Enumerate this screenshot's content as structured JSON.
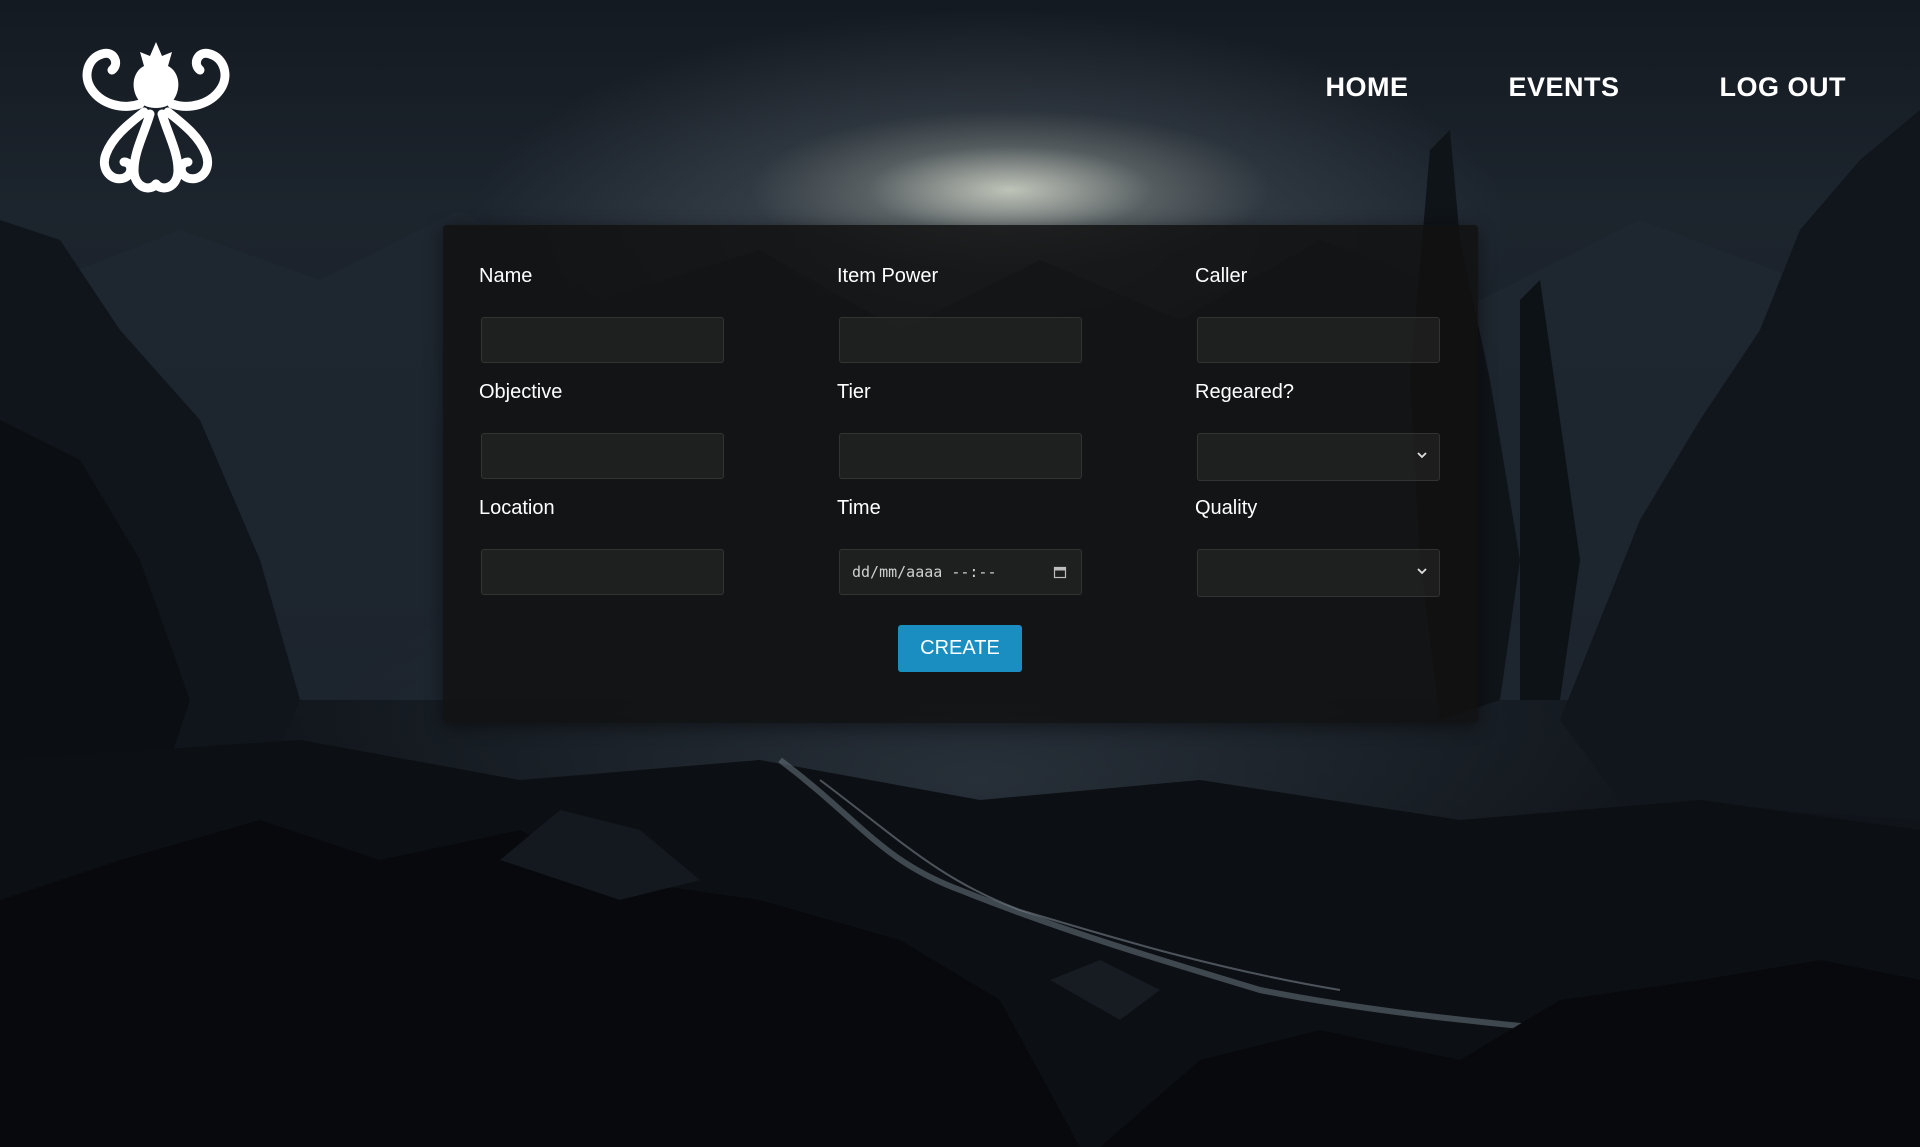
{
  "logo": {
    "icon": "kraken-icon"
  },
  "nav": {
    "items": [
      {
        "label": "HOME"
      },
      {
        "label": "EVENTS"
      },
      {
        "label": "LOG OUT"
      }
    ]
  },
  "form": {
    "fields": {
      "name": {
        "label": "Name",
        "value": ""
      },
      "item_power": {
        "label": "Item Power",
        "value": ""
      },
      "caller": {
        "label": "Caller",
        "value": ""
      },
      "objective": {
        "label": "Objective",
        "value": ""
      },
      "tier": {
        "label": "Tier",
        "value": ""
      },
      "regeared": {
        "label": "Regeared?",
        "value": ""
      },
      "location": {
        "label": "Location",
        "value": ""
      },
      "time": {
        "label": "Time",
        "placeholder": "dd/mm/aaaa --:--"
      },
      "quality": {
        "label": "Quality",
        "value": ""
      }
    },
    "submit_label": "CREATE"
  },
  "colors": {
    "accent": "#1a8ec0",
    "panel": "#121212",
    "text": "#ffffff"
  }
}
